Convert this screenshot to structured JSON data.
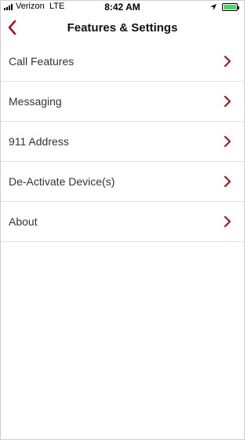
{
  "status_bar": {
    "carrier": "Verizon",
    "network": "LTE",
    "time": "8:42 AM",
    "location_icon": "location-arrow-icon",
    "battery_icon": "battery-icon",
    "battery_level": 1.0,
    "battery_color": "#4cd964"
  },
  "nav": {
    "title": "Features & Settings",
    "back_icon": "chevron-left-icon"
  },
  "accent_color": "#b0141c",
  "menu": {
    "items": [
      {
        "label": "Call Features"
      },
      {
        "label": "Messaging"
      },
      {
        "label": "911 Address"
      },
      {
        "label": "De-Activate Device(s)"
      },
      {
        "label": "About"
      }
    ],
    "item_icon": "chevron-right-icon"
  }
}
